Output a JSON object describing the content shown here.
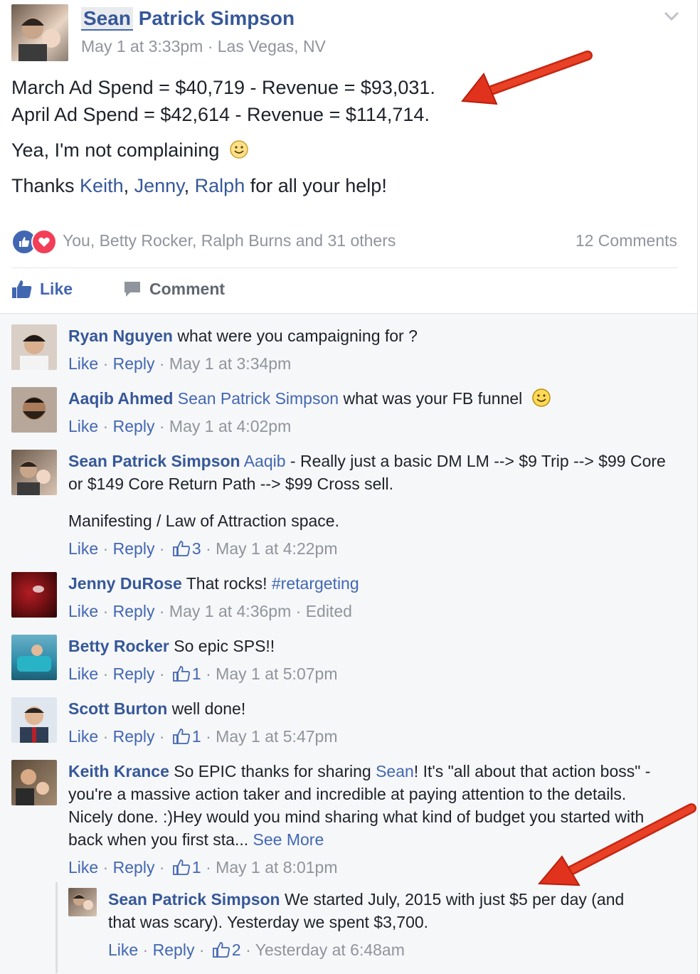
{
  "post": {
    "author": "Sean Patrick Simpson",
    "meta": "May 1 at 3:33pm · Las Vegas, NV",
    "line1": "March Ad Spend = $40,719 - Revenue = $93,031.",
    "line2": "April Ad Spend = $42,614 - Revenue = $114,714.",
    "line3": "Yea, I'm not complaining",
    "thanks_prefix": "Thanks ",
    "thanks_names": [
      "Keith",
      "Jenny",
      "Ralph"
    ],
    "thanks_suffix": " for all your help!",
    "reactions_text": "You, Betty Rocker, Ralph Burns and 31 others",
    "comments_count": "12 Comments",
    "like_label": "Like",
    "comment_label": "Comment"
  },
  "labels": {
    "like": "Like",
    "reply": "Reply",
    "dot": "·",
    "see_more": "See More"
  },
  "comments": [
    {
      "name": "Ryan Nguyen",
      "text": " what were you campaigning for ?",
      "time": "May 1 at 3:34pm"
    },
    {
      "name": "Aaqib Ahmed",
      "tag": "Sean Patrick Simpson",
      "text": " what was your FB funnel",
      "time": "May 1 at 4:02pm"
    },
    {
      "name": "Sean Patrick Simpson",
      "tag": "Aaqib",
      "text": " - Really just a basic DM LM --> $9 Trip --> $99 Core or $149 Core Return Path --> $99 Cross sell.",
      "text2": "Manifesting / Law of Attraction space.",
      "likes": "3",
      "time": "May 1 at 4:22pm"
    },
    {
      "name": "Jenny DuRose",
      "text": " That rocks! ",
      "hashtag": "#retargeting",
      "time": "May 1 at 4:36pm",
      "edited": "Edited"
    },
    {
      "name": "Betty Rocker",
      "text": " So epic SPS!!",
      "likes": "1",
      "time": "May 1 at 5:07pm"
    },
    {
      "name": "Scott Burton",
      "text": " well done!",
      "likes": "1",
      "time": "May 1 at 5:47pm"
    },
    {
      "name": "Keith Krance",
      "text": " So EPIC thanks for sharing ",
      "tag": "Sean",
      "text_after": "! It's \"all about that action boss\" - you're a massive action taker and incredible at paying attention to the details. Nicely done. :)Hey would you mind sharing what kind of budget you started with back when you first sta... ",
      "likes": "1",
      "time": "May 1 at 8:01pm"
    }
  ],
  "reply": {
    "name": "Sean Patrick Simpson",
    "text": " We started July, 2015 with just $5 per day (and that was scary). Yesterday we spent $3,700.",
    "likes": "2",
    "time": "Yesterday at 6:48am"
  },
  "colors": {
    "link": "#365899",
    "like_blue": "#4267b2",
    "meta_gray": "#90949c",
    "arrow_red": "#e0321c",
    "love_red": "#f33e58"
  }
}
